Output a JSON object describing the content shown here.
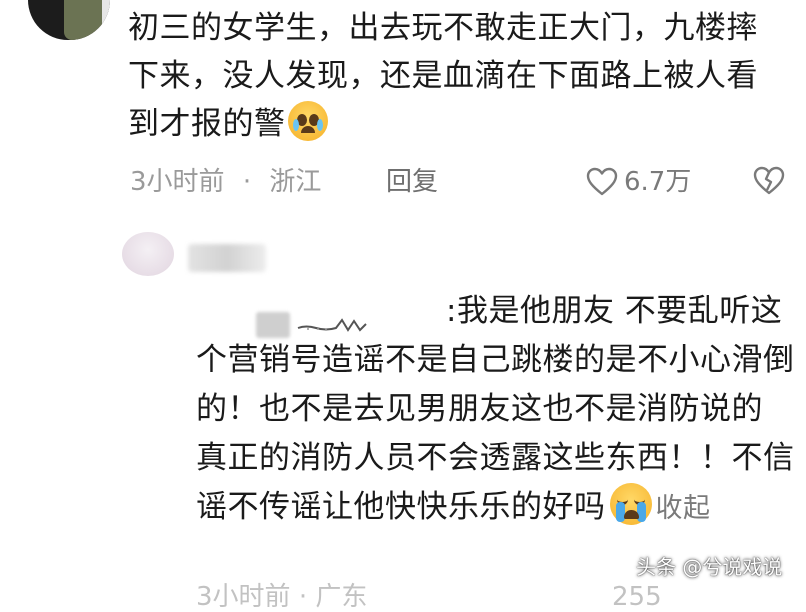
{
  "comment1": {
    "text": "初三的女学生，出去玩不敢走正大门，九楼摔下来，没人发现，还是血滴在下面路上被人看到才报的警",
    "emoji": "pleading-face-tears",
    "time": "3小时前",
    "dot": "·",
    "location": "浙江",
    "reply_label": "回复",
    "likes": "6.7万"
  },
  "comment2": {
    "name_suffix": ":",
    "text": "我是他朋友 不要乱听这个营销号造谣不是自己跳楼的是不小心滑倒的！也不是去见男朋友这也不是消防说的 真正的消防人员不会透露这些东西！！不信谣不传谣让他快快乐乐的好吗",
    "emoji": "loudly-crying-face",
    "collapse_label": "收起",
    "partial_time": "3小时前",
    "partial_location": "广东",
    "partial_likes": "255"
  },
  "watermark": "头条 @兮说戏说",
  "colors": {
    "text": "#1a1a1a",
    "meta": "#9a9a9a",
    "reply": "#6f6f6f"
  },
  "icons": [
    "heart-icon",
    "broken-heart-icon"
  ]
}
